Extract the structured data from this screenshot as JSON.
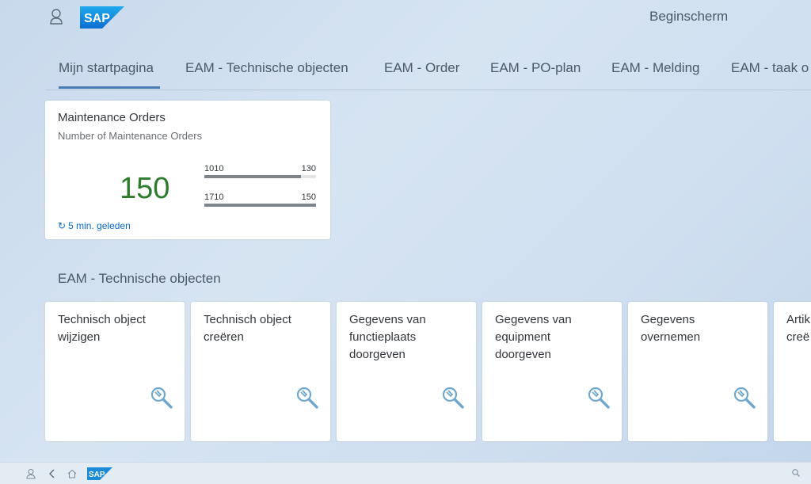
{
  "header": {
    "title": "Beginscherm",
    "logo_text": "SAP"
  },
  "tabs": [
    {
      "label": "Mijn startpagina",
      "active": true
    },
    {
      "label": "EAM - Technische objecten"
    },
    {
      "label": "EAM - Order"
    },
    {
      "label": "EAM - PO-plan"
    },
    {
      "label": "EAM - Melding"
    },
    {
      "label": "EAM - taak o"
    }
  ],
  "kpi_tile": {
    "title": "Maintenance Orders",
    "subtitle": "Number of Maintenance Orders",
    "value": "150",
    "value_color": "#2b7d2b",
    "bars": [
      {
        "label": "1010",
        "value": "130",
        "fraction": 0.867
      },
      {
        "label": "1710",
        "value": "150",
        "fraction": 1.0
      }
    ],
    "footer": "5 min. geleden"
  },
  "group": {
    "title": "EAM - Technische objecten",
    "tiles": [
      {
        "title": "Technisch object\nwijzigen"
      },
      {
        "title": "Technisch object\ncreëren"
      },
      {
        "title": "Gegevens van\nfunctieplaats\ndoorgeven"
      },
      {
        "title": "Gegevens van\nequipment\ndoorgeven"
      },
      {
        "title": "Gegevens\novernemen"
      },
      {
        "title": "Artik\ncreë"
      }
    ]
  },
  "bottom_bar": {
    "logo_text": "SAP"
  },
  "colors": {
    "accent": "#0a6ed1",
    "sap_blue": "#1a8bd6"
  }
}
